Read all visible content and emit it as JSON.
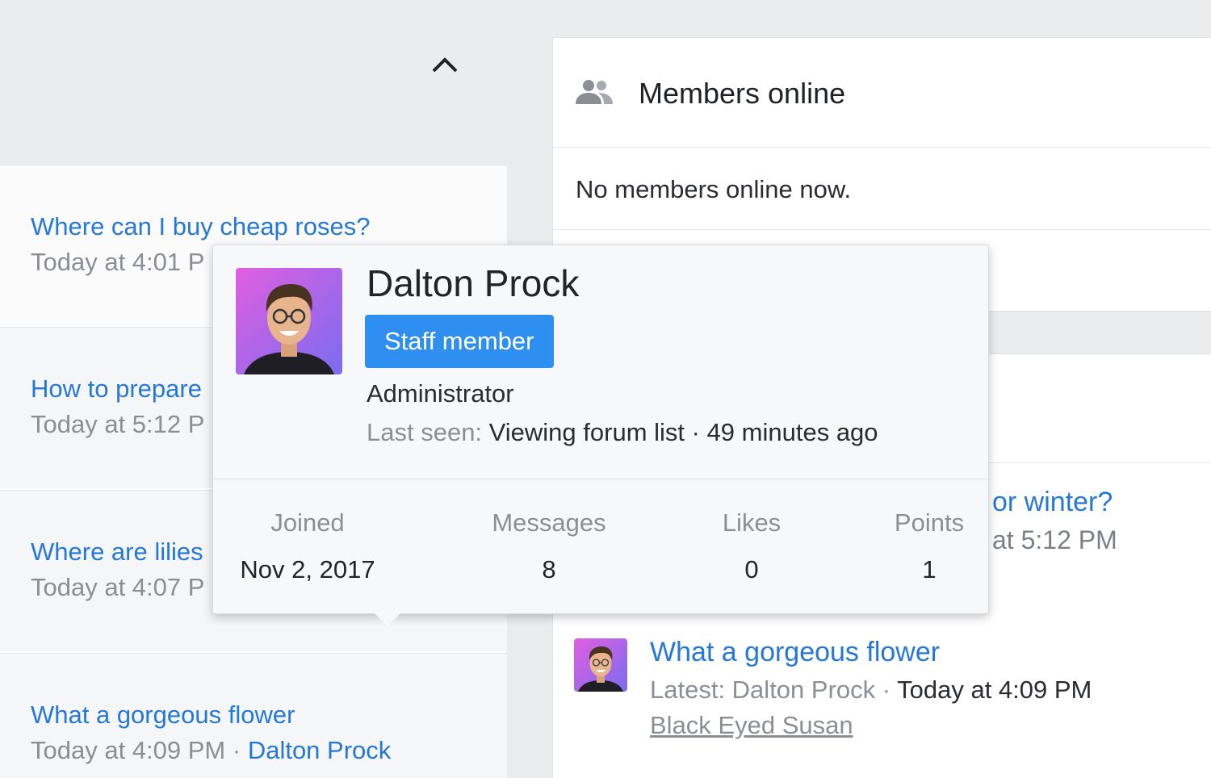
{
  "left_threads": [
    {
      "title": "Where can I buy cheap roses?",
      "meta": "Today at 4:01 P",
      "author": ""
    },
    {
      "title": "How to prepare",
      "meta": "Today at 5:12 P",
      "author": ""
    },
    {
      "title": "Where are lilies",
      "meta": "Today at 4:07 P",
      "author": ""
    },
    {
      "title": "What a gorgeous flower",
      "meta": "Today at 4:09 PM · ",
      "author": "Dalton Prock"
    }
  ],
  "members_online": {
    "title": "Members online",
    "empty_text": "No members online now."
  },
  "latest": {
    "partial_title": "or winter?",
    "partial_meta": "at 5:12 PM",
    "item_title": "What a gorgeous flower",
    "item_latest_label": "Latest: Dalton Prock · ",
    "item_time": "Today at 4:09 PM",
    "item_forum": "Black Eyed Susan"
  },
  "tooltip": {
    "name": "Dalton Prock",
    "badge": "Staff member",
    "role": "Administrator",
    "last_seen_label": "Last seen:",
    "last_seen_value": " Viewing forum list · 49 minutes ago",
    "stats": [
      {
        "label": "Joined",
        "value": "Nov 2, 2017"
      },
      {
        "label": "Messages",
        "value": "8"
      },
      {
        "label": "Likes",
        "value": "0"
      },
      {
        "label": "Points",
        "value": "1"
      }
    ]
  },
  "colors": {
    "link": "#2577d8",
    "badge": "#2f8ff0",
    "muted": "#8b8f94"
  }
}
